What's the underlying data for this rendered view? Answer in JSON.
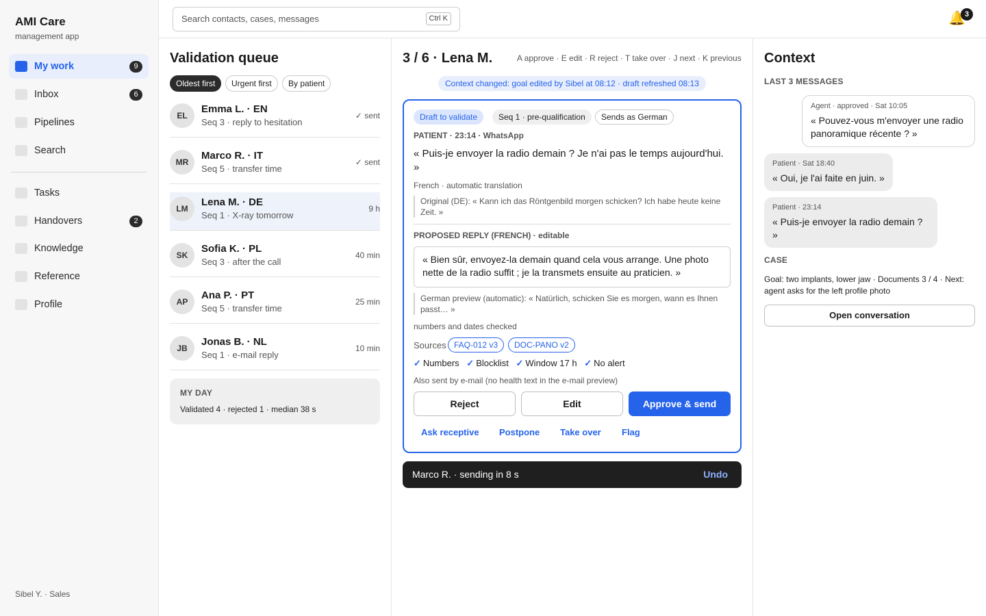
{
  "app": {
    "name": "AMI Care",
    "subtitle": "management app"
  },
  "sidebar": {
    "items": [
      {
        "label": "My work",
        "badge": "9",
        "active": true
      },
      {
        "label": "Inbox",
        "badge": "6"
      },
      {
        "label": "Pipelines",
        "badge": ""
      },
      {
        "label": "Search",
        "badge": ""
      },
      {
        "label": "Tasks",
        "badge": ""
      },
      {
        "label": "Handovers",
        "badge": "2"
      },
      {
        "label": "Knowledge",
        "badge": ""
      },
      {
        "label": "Reference",
        "badge": ""
      },
      {
        "label": "Profile",
        "badge": ""
      }
    ],
    "user": "Sibel Y. · Sales"
  },
  "topbar": {
    "search_placeholder": "Search contacts, cases, messages",
    "search_shortcut": "Ctrl K",
    "notifications_count": "3"
  },
  "queue": {
    "title": "Validation queue",
    "sorts": [
      "Oldest first",
      "Urgent first",
      "By patient"
    ],
    "items": [
      {
        "initials": "EL",
        "name": "Emma L. · EN",
        "sub": "Seq 3 · reply to hesitation",
        "meta": "✓ sent"
      },
      {
        "initials": "MR",
        "name": "Marco R. · IT",
        "sub": "Seq 5 · transfer time",
        "meta": "✓ sent"
      },
      {
        "initials": "LM",
        "name": "Lena M. · DE",
        "sub": "Seq 1 · X-ray tomorrow",
        "meta": "9 h"
      },
      {
        "initials": "SK",
        "name": "Sofia K. · PL",
        "sub": "Seq 3 · after the call",
        "meta": "40 min"
      },
      {
        "initials": "AP",
        "name": "Ana P. · PT",
        "sub": "Seq 5 · transfer time",
        "meta": "25 min"
      },
      {
        "initials": "JB",
        "name": "Jonas B. · NL",
        "sub": "Seq 1 · e-mail reply",
        "meta": "10 min"
      }
    ],
    "my_day": {
      "title": "MY DAY",
      "text": "Validated 4 · rejected 1 · median 38 s"
    }
  },
  "detail": {
    "title": "3 / 6 · Lena M.",
    "shortcuts": "A approve · E edit · R reject · T take over · J next · K previous",
    "context_banner": "Context changed: goal edited by Sibel at 08:12 · draft refreshed 08:13",
    "tags": [
      "Draft to validate",
      "Seq 1 · pre-qualification",
      "Sends as German"
    ],
    "patient_label": "PATIENT · 23:14 · WhatsApp",
    "patient_message": "« Puis-je envoyer la radio demain ? Je n'ai pas le temps aujourd'hui. »",
    "translation_note": "French · automatic translation",
    "original": "Original (DE): « Kann ich das Röntgenbild morgen schicken? Ich habe heute keine Zeit. »",
    "reply_label": "PROPOSED REPLY (FRENCH) · editable",
    "reply_text": "« Bien sûr, envoyez-la demain quand cela vous arrange. Une photo nette de la radio suffit ; je la transmets ensuite au praticien. »",
    "german_preview": "German preview (automatic): « Natürlich, schicken Sie es morgen, wann es Ihnen passt… »",
    "checked_note": "numbers and dates checked",
    "sources_label": "Sources",
    "sources": [
      "FAQ-012 v3",
      "DOC-PANO v2"
    ],
    "checks": [
      "Numbers",
      "Blocklist",
      "Window 17 h",
      "No alert"
    ],
    "email_note": "Also sent by e-mail (no health text in the e-mail preview)",
    "buttons": {
      "reject": "Reject",
      "edit": "Edit",
      "approve": "Approve & send"
    },
    "links": [
      "Ask receptive",
      "Postpone",
      "Take over",
      "Flag"
    ],
    "toast": {
      "text": "Marco R. · sending in 8 s",
      "undo": "Undo"
    }
  },
  "context": {
    "title": "Context",
    "messages_label": "LAST 3 MESSAGES",
    "messages": [
      {
        "meta": "Agent · approved · Sat 10:05",
        "text": "« Pouvez-vous m'envoyer une radio panoramique récente ? »"
      },
      {
        "meta": "Patient · Sat 18:40",
        "text": "« Oui, je l'ai faite en juin. »"
      },
      {
        "meta": "Patient · 23:14",
        "text": "« Puis-je envoyer la radio demain ? »"
      }
    ],
    "case_label": "CASE",
    "case_text": "Goal: two implants, lower jaw · Documents 3 / 4 · Next: agent asks for the left profile photo",
    "open_button": "Open conversation"
  },
  "colors": {
    "accent": "#2563eb",
    "dark": "#2b2b2b"
  }
}
